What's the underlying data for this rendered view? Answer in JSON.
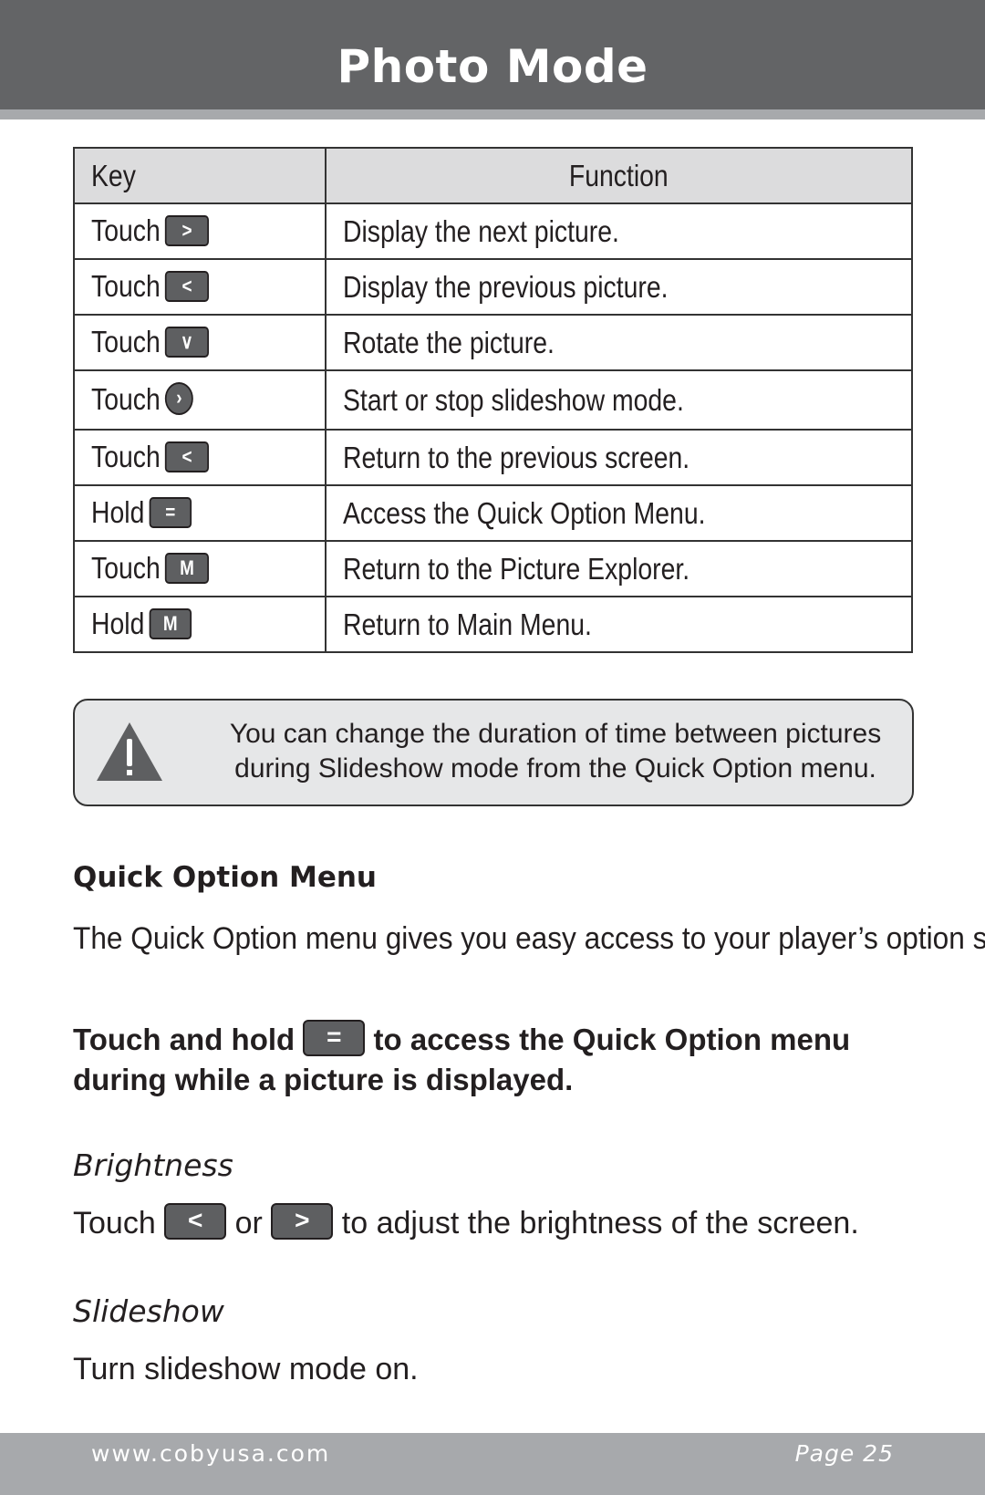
{
  "header": {
    "title": "Photo Mode"
  },
  "table": {
    "headers": {
      "key": "Key",
      "function": "Function"
    },
    "rows": [
      {
        "action": "Touch",
        "key_icon": "right-arrow-key",
        "key_glyph": ">",
        "function": "Display the next picture."
      },
      {
        "action": "Touch",
        "key_icon": "left-arrow-key",
        "key_glyph": "<",
        "function": "Display the previous picture."
      },
      {
        "action": "Touch",
        "key_icon": "down-arrow-key",
        "key_glyph": "∨",
        "function": "Rotate the picture."
      },
      {
        "action": "Touch",
        "key_icon": "play-circle-key",
        "key_glyph": "›",
        "function": "Start or stop slideshow mode."
      },
      {
        "action": "Touch",
        "key_icon": "left-arrow-key",
        "key_glyph": "<",
        "function": "Return to the previous screen."
      },
      {
        "action": "Hold",
        "key_icon": "menu-key",
        "key_glyph": "=",
        "function": "Access the Quick Option Menu."
      },
      {
        "action": "Touch",
        "key_icon": "m-key",
        "key_glyph": "M",
        "function": "Return to the Picture Explorer."
      },
      {
        "action": "Hold",
        "key_icon": "m-key",
        "key_glyph": "M",
        "function": "Return to Main Menu."
      }
    ]
  },
  "note": {
    "icon": "warning-icon",
    "text": "You can change the duration of time between pictures during Slideshow mode from the Quick Option menu."
  },
  "quick_option": {
    "heading": "Quick Option Menu",
    "intro": "The Quick Option menu gives you easy access to your player’s option settings.",
    "instruction_before": "Touch and hold",
    "instruction_icon_glyph": "=",
    "instruction_after": "to access the Quick Option menu during while a picture is displayed."
  },
  "brightness": {
    "heading": "Brightness",
    "text_before": "Touch",
    "left_glyph": "<",
    "text_or": "or",
    "right_glyph": ">",
    "text_after": "to adjust the brightness of the screen."
  },
  "slideshow": {
    "heading": "Slideshow",
    "text": "Turn slideshow mode on."
  },
  "footer": {
    "url": "www.cobyusa.com",
    "page": "Page 25"
  }
}
